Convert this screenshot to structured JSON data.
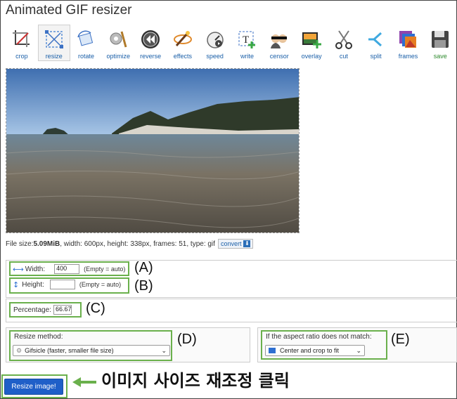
{
  "app": {
    "title": "Animated GIF resizer"
  },
  "toolbar": {
    "items": [
      {
        "label": "crop",
        "icon": "crop-icon"
      },
      {
        "label": "resize",
        "icon": "resize-icon",
        "active": true
      },
      {
        "label": "rotate",
        "icon": "rotate-icon"
      },
      {
        "label": "optimize",
        "icon": "optimize-icon"
      },
      {
        "label": "reverse",
        "icon": "reverse-icon"
      },
      {
        "label": "effects",
        "icon": "effects-icon"
      },
      {
        "label": "speed",
        "icon": "speed-icon"
      },
      {
        "label": "write",
        "icon": "write-icon"
      },
      {
        "label": "censor",
        "icon": "censor-icon"
      },
      {
        "label": "overlay",
        "icon": "overlay-icon"
      },
      {
        "label": "cut",
        "icon": "cut-icon"
      },
      {
        "label": "split",
        "icon": "split-icon"
      },
      {
        "label": "frames",
        "icon": "frames-icon"
      },
      {
        "label": "save",
        "icon": "save-icon"
      }
    ]
  },
  "fileinfo": {
    "prefix": "File size: ",
    "size": "5.09MiB",
    "details": ", width: 600px, height: 338px, frames: 51, type: gif",
    "convert_label": "convert"
  },
  "form": {
    "width_label": "Width:",
    "width_value": "400",
    "width_hint": "(Empty = auto)",
    "height_label": "Height:",
    "height_value": "",
    "height_hint": "(Empty = auto)",
    "percentage_label": "Percentage:",
    "percentage_value": "66.67",
    "method_label": "Resize method:",
    "method_value": "Gifsicle (faster, smaller file size)",
    "aspect_label": "If the aspect ratio does not match:",
    "aspect_value": "Center and crop to fit",
    "submit_label": "Resize image!"
  },
  "annotations": {
    "a": "(A)",
    "b": "(B)",
    "c": "(C)",
    "d": "(D)",
    "e": "(E)",
    "click_text": "이미지 사이즈 재조정 클릭"
  },
  "colors": {
    "accent_green": "#6ab04c",
    "button_blue": "#1f5fc8",
    "link_blue": "#1a5fa8"
  }
}
